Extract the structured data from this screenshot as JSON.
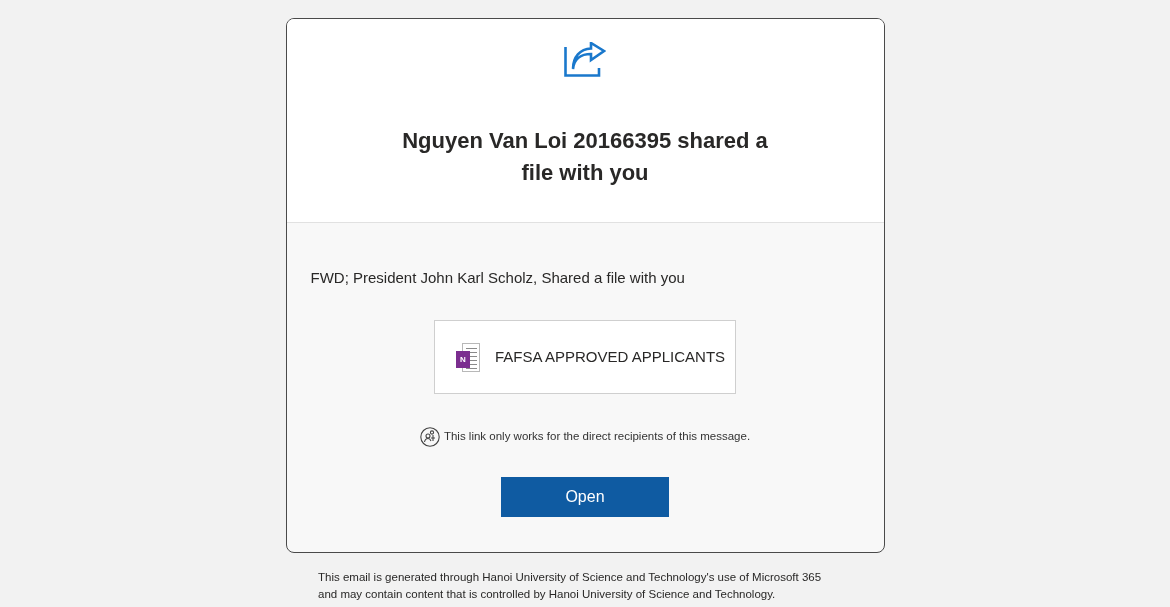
{
  "header": {
    "title": "Nguyen Van Loi 20166395 shared a file with you"
  },
  "message": "FWD; President John Karl Scholz, Shared a file with you",
  "file": {
    "icon_letter": "N",
    "name": "FAFSA APPROVED APPLICANTS"
  },
  "access_note": "This link only works for the direct recipients of this message.",
  "open_button": {
    "label": "Open"
  },
  "footer": "This email is generated through Hanoi University of Science and Technology's use of Microsoft 365 and may contain content that is controlled by Hanoi University of Science and Technology."
}
